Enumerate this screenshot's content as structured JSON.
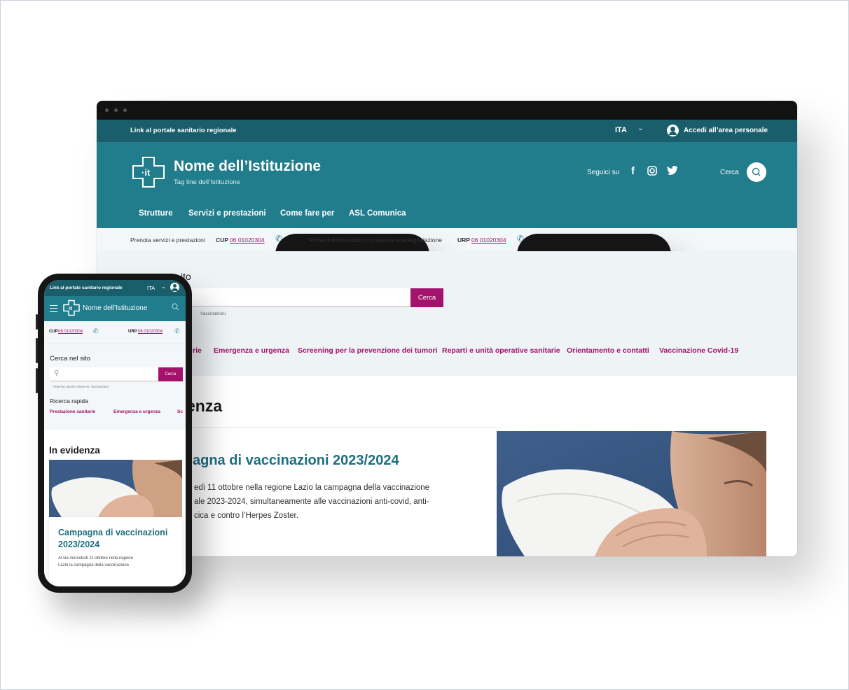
{
  "colors": {
    "teal_dark": "#1a5e6b",
    "teal": "#217c8c",
    "accent": "#a3136b",
    "title_teal": "#1d6f80"
  },
  "desktop": {
    "slim": {
      "link": "Link al portale sanitario regionale",
      "language": "ITA",
      "login": "Accedi all’area personale"
    },
    "header": {
      "logo_text": "·it",
      "title": "Nome dell’Istituzione",
      "tagline": "Tag line dell’Istituzione",
      "follow": "Seguici su",
      "social": [
        "facebook-icon",
        "instagram-icon",
        "twitter-icon"
      ],
      "search_label": "Cerca"
    },
    "nav": [
      "Strutture",
      "Servizi e prestazioni",
      "Come fare per",
      "ASL Comunica"
    ],
    "contacts": {
      "left_text": "Prenota servizi e prestazioni",
      "left_code": "CUP",
      "left_number": "06 01020304",
      "right_text": "Richiedi informazioni o presenta una segnalazione",
      "right_code": "URP",
      "right_number": "06 01020304"
    },
    "search": {
      "heading_visible": "ito",
      "button": "Cerca",
      "hint_visible": "Vaccinazioni"
    },
    "quick_links": [
      "rie",
      "Emergenza e urgenza",
      "Screening per la prevenzione dei tumori",
      "Reparti e unità operative sanitarie",
      "Orientamento e contatti",
      "Vaccinazione Covid-19"
    ],
    "evidence": {
      "heading_visible": "enza",
      "card_title_visible": "agna di vaccinazioni 2023/2024",
      "card_text_lines": [
        "edì 11 ottobre nella regione Lazio la campagna della vaccinazione",
        "ale 2023-2024, simultaneamente alle vaccinazioni anti-covid, anti-",
        "cica e contro l’Herpes Zoster."
      ]
    }
  },
  "mobile": {
    "slim": {
      "link": "Link al portale sanitario regionale",
      "language": "ITA"
    },
    "header": {
      "title": "Nome dell’Istituzione"
    },
    "contacts": {
      "left_code": "CUP",
      "left_number": "06 01020304",
      "right_code": "URP",
      "right_number": "06 01020304"
    },
    "search": {
      "heading": "Cerca nel sito",
      "button": "Cerca",
      "hint": "*Inserisci parole chiave es: Vaccinazioni",
      "quick_heading": "Ricerca rapida",
      "quick_links": [
        "Prestazione sanitarie",
        "Emergenza e urgenza",
        "Sc"
      ]
    },
    "evidence": {
      "heading": "In evidenza",
      "card_title": "Campagna di vaccinazioni 2023/2024",
      "card_text_lines": [
        "Al via mercoledì 11 ottobre nella regione",
        "Lazio la campagna della vaccinazione"
      ]
    }
  }
}
